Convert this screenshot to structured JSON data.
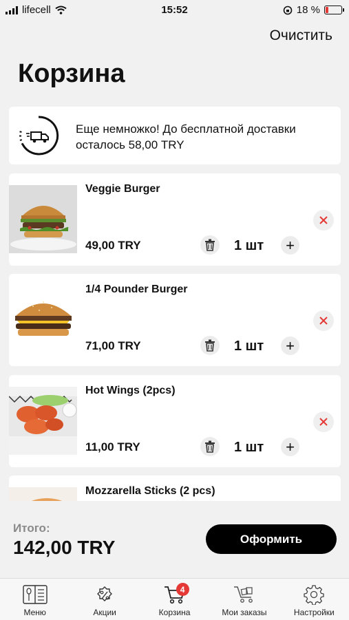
{
  "status_bar": {
    "carrier": "lifecell",
    "time": "15:52",
    "battery": "18 %",
    "battery_level": 0.18
  },
  "header": {
    "clear_label": "Очистить",
    "title": "Корзина"
  },
  "delivery_notice": {
    "text": "Еще немножко! До бесплатной доставки осталось 58,00 TRY",
    "icon": "delivery-truck-progress-icon"
  },
  "cart_items": [
    {
      "name": "Veggie Burger",
      "price": "49,00 TRY",
      "quantity": "1 шт"
    },
    {
      "name": "1/4 Pounder Burger",
      "price": "71,00 TRY",
      "quantity": "1 шт"
    },
    {
      "name": "Hot Wings (2pcs)",
      "price": "11,00 TRY",
      "quantity": "1 шт"
    },
    {
      "name": "Mozzarella Sticks (2 pcs)"
    }
  ],
  "footer": {
    "total_label": "Итого:",
    "total_value": "142,00 TRY",
    "checkout_label": "Оформить"
  },
  "tab_bar": {
    "tabs": [
      {
        "label": "Меню",
        "icon": "menu-book-icon"
      },
      {
        "label": "Акции",
        "icon": "discount-icon"
      },
      {
        "label": "Корзина",
        "icon": "cart-icon",
        "badge": "4"
      },
      {
        "label": "Мои заказы",
        "icon": "orders-cart-icon"
      },
      {
        "label": "Настройки",
        "icon": "gear-icon"
      }
    ]
  },
  "colors": {
    "accent_red": "#e53935",
    "button_black": "#000000",
    "background": "#f1f1f1"
  }
}
